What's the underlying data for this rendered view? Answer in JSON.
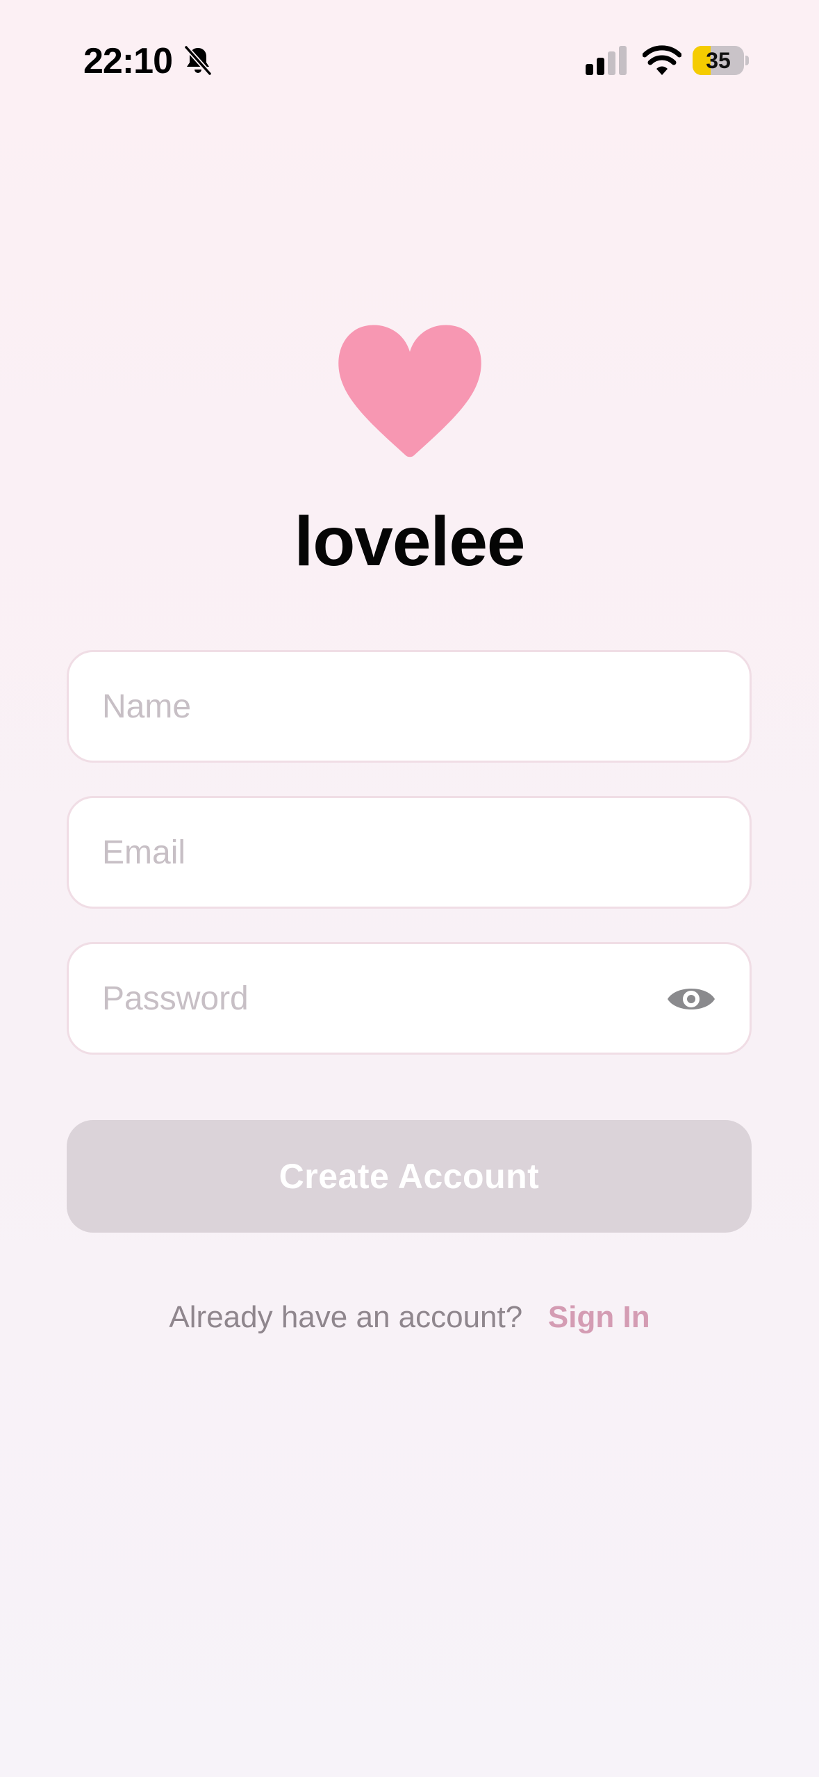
{
  "status_bar": {
    "time": "22:10",
    "battery_level": "35",
    "battery_fraction": 0.35,
    "icons": [
      "bell-muted-icon",
      "signal-icon",
      "wifi-icon",
      "battery-icon"
    ]
  },
  "logo": {
    "icon": "heart-icon",
    "color": "#f797b2"
  },
  "app_title": "lovelee",
  "form": {
    "name": {
      "placeholder": "Name",
      "value": ""
    },
    "email": {
      "placeholder": "Email",
      "value": ""
    },
    "password": {
      "placeholder": "Password",
      "value": "",
      "toggle_icon": "eye-icon"
    }
  },
  "create_button_label": "Create Account",
  "signin": {
    "prompt": "Already have an account?",
    "link": "Sign In"
  },
  "colors": {
    "accent": "#d49cb3",
    "heart": "#f797b2",
    "button_disabled": "#dbd3d9",
    "battery_fill": "#f5cc00"
  }
}
